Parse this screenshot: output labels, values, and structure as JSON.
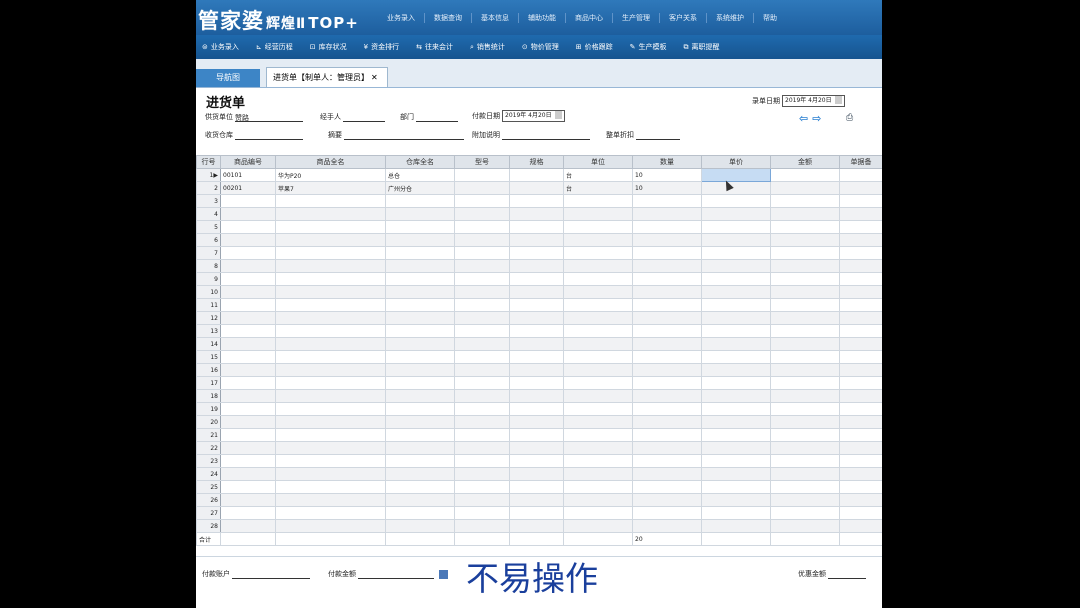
{
  "app": {
    "logo": "管家婆",
    "logo_sub": "辉煌Ⅱ",
    "logo_edition": "TOP+"
  },
  "menu": [
    "业务录入",
    "数据查询",
    "基本信息",
    "辅助功能",
    "商品中心",
    "生产管理",
    "客户关系",
    "系统维护",
    "帮助"
  ],
  "toolbar": [
    {
      "icon": "order-icon",
      "glyph": "⊜",
      "label": "业务录入"
    },
    {
      "icon": "chart-icon",
      "glyph": "⊾",
      "label": "经营历程"
    },
    {
      "icon": "stock-icon",
      "glyph": "⊡",
      "label": "库存状况"
    },
    {
      "icon": "money-icon",
      "glyph": "¥",
      "label": "资金排行"
    },
    {
      "icon": "account-icon",
      "glyph": "⇆",
      "label": "往来会计"
    },
    {
      "icon": "search-icon",
      "glyph": "⌕",
      "label": "销售统计"
    },
    {
      "icon": "goods-icon",
      "glyph": "⊙",
      "label": "物价管理"
    },
    {
      "icon": "monitor-icon",
      "glyph": "⊞",
      "label": "价格跟踪"
    },
    {
      "icon": "tool-icon",
      "glyph": "✎",
      "label": "生产模板"
    },
    {
      "icon": "window-icon",
      "glyph": "⧉",
      "label": "离职提醒"
    }
  ],
  "tabs": {
    "nav_label": "导航图",
    "doc_label": "进货单【制单人：管理员】",
    "close": "✕"
  },
  "form": {
    "title": "进货单",
    "doc_date_label": "录单日期",
    "doc_date_value": "2019年 4月20日",
    "supplier_label": "供货单位",
    "supplier_value": "赞路",
    "handler_label": "经手人",
    "dept_label": "部门",
    "pay_date_label": "付款日期",
    "pay_date_value": "2019年 4月20日",
    "warehouse_label": "收货仓库",
    "summary_label": "摘要",
    "extra_label": "附加说明",
    "discount_label": "整单折扣"
  },
  "grid": {
    "columns": [
      "行号",
      "商品编号",
      "商品全名",
      "仓库全名",
      "型号",
      "规格",
      "单位",
      "数量",
      "单价",
      "金额",
      "单据备"
    ],
    "rows": [
      {
        "row_no": "1",
        "marker": "▶",
        "code": "00101",
        "name": "华为P20",
        "warehouse": "总仓",
        "model": "",
        "spec": "",
        "unit": "台",
        "qty": "10",
        "price": "",
        "amount": "",
        "note": ""
      },
      {
        "row_no": "2",
        "marker": "",
        "code": "00201",
        "name": "苹果7",
        "warehouse": "广州分仓",
        "model": "",
        "spec": "",
        "unit": "台",
        "qty": "10",
        "price": "",
        "amount": "",
        "note": ""
      }
    ],
    "empty_row_numbers": [
      "3",
      "4",
      "5",
      "6",
      "7",
      "8",
      "9",
      "10",
      "11",
      "12",
      "13",
      "14",
      "15",
      "16",
      "17",
      "18",
      "19",
      "20",
      "21",
      "22",
      "23",
      "24",
      "25",
      "26",
      "27",
      "28"
    ],
    "total_label": "合计",
    "total_qty": "20"
  },
  "footer": {
    "pay_account_label": "付款账户",
    "pay_amount_label": "付款金额",
    "discount_amount_label": "优惠金额"
  },
  "overlay_caption": "不易操作",
  "colors": {
    "banner": "#1f6aae",
    "caption": "#1a3f9c",
    "selected_cell": "#c6dcf3"
  }
}
